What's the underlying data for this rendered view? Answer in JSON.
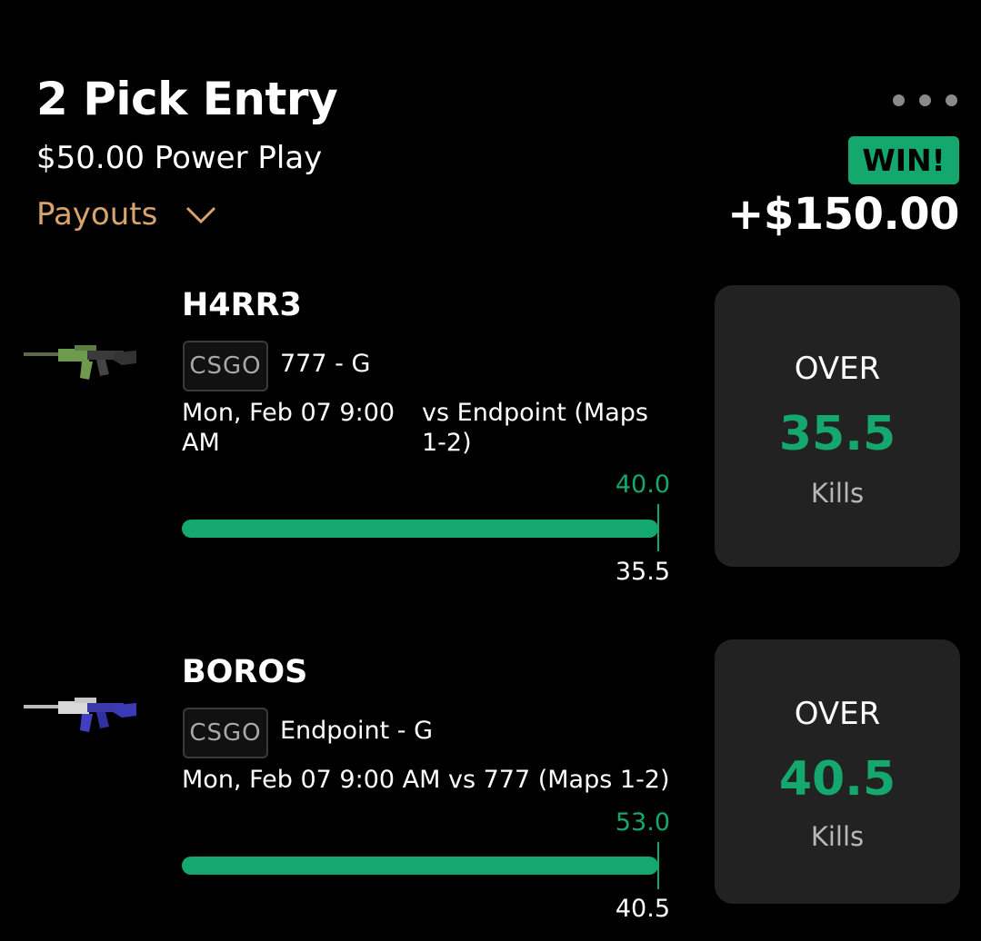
{
  "header": {
    "title": "2 Pick Entry",
    "subtitle": "$50.00 Power Play",
    "payouts_label": "Payouts",
    "result_badge": "WIN!",
    "result_amount": "+$150.00"
  },
  "colors": {
    "accent": "#15a86e",
    "payouts": "#d9a46c",
    "card_bg": "#222222",
    "background": "#000000"
  },
  "picks": [
    {
      "player": "H4RR3",
      "icon": "rifle-green-icon",
      "league": "CSGO",
      "team": "777 - G",
      "date": "Mon, Feb 07 9:00 AM",
      "opponent": "vs Endpoint (Maps 1-2)",
      "actual": "40.0",
      "line": "35.5",
      "progress": 1.0,
      "direction": "OVER",
      "projection": "35.5",
      "stat": "Kills"
    },
    {
      "player": "BOROS",
      "icon": "rifle-blue-icon",
      "league": "CSGO",
      "team": "Endpoint - G",
      "date_opponent": "Mon, Feb 07 9:00 AM vs 777 (Maps 1-2)",
      "actual": "53.0",
      "line": "40.5",
      "progress": 1.0,
      "direction": "OVER",
      "projection": "40.5",
      "stat": "Kills"
    }
  ]
}
